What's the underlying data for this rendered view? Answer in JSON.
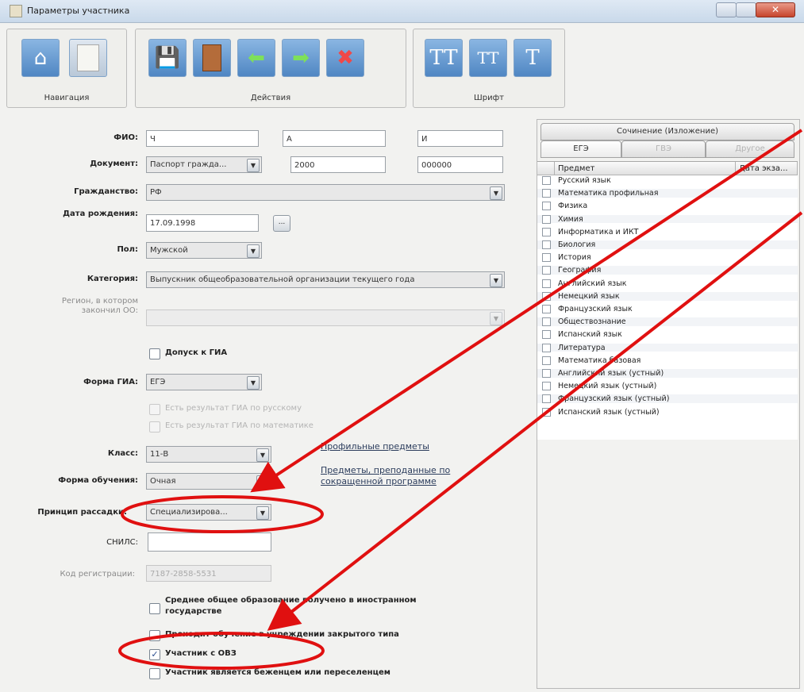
{
  "window": {
    "title": "Параметры участника"
  },
  "toolbar": {
    "groups": [
      {
        "label": "Навигация"
      },
      {
        "label": "Действия"
      },
      {
        "label": "Шрифт"
      }
    ],
    "icons": {
      "home": "home-icon",
      "document": "document-icon",
      "save": "save-icon",
      "exit": "exit-door-icon",
      "back": "arrow-left-icon",
      "forward": "arrow-right-icon",
      "delete": "delete-x-icon",
      "font_decrease": "font-decrease-icon",
      "font_increase": "font-increase-icon",
      "font_default": "font-default-icon"
    },
    "font_glyph_1": "TT",
    "font_glyph_2": "TT",
    "font_glyph_3": "T"
  },
  "form": {
    "fio_label": "ФИО:",
    "fio_last": "Ч",
    "fio_first": "А",
    "fio_middle": "И",
    "document_label": "Документ:",
    "document_type": "Паспорт гражда...",
    "document_series": "2000",
    "document_number": "000000",
    "citizenship_label": "Гражданство:",
    "citizenship_value": "РФ",
    "birthdate_label": "Дата рождения:",
    "birthdate_value": "17.09.1998",
    "birthdate_button": "...",
    "sex_label": "Пол:",
    "sex_value": "Мужской",
    "category_label": "Категория:",
    "category_value": "Выпускник общеобразовательной организации текущего года",
    "region_label": "Регион, в котором закончил ОО:",
    "gia_admission_label": "Допуск к ГИА",
    "gia_form_label": "Форма ГИА:",
    "gia_form_value": "ЕГЭ",
    "gia_result_russian": "Есть результат ГИА по русскому",
    "gia_result_math": "Есть результат ГИА по математике",
    "class_label": "Класс:",
    "class_value": "11-В",
    "study_form_label": "Форма обучения:",
    "study_form_value": "Очная",
    "seating_label": "Принцип рассадки:",
    "seating_value": "Специализирова...",
    "snils_label": "СНИЛС:",
    "snils_value": "",
    "reg_code_label": "Код регистрации:",
    "reg_code_value": "7187-2858-5531",
    "link_profile": "Профильные предметы",
    "link_reduced": "Предметы, преподанные по сокращенной программе",
    "chk_foreign": "Среднее общее образование получено в иностранном государстве",
    "chk_closed": "Проходит обучение в учреждении закрытого типа",
    "chk_ovz": "Участник с ОВЗ",
    "chk_refugee": "Участник является беженцем или переселенцем",
    "checked_mark": "✓"
  },
  "right": {
    "tab_essay": "Сочинение (Изложение)",
    "tab_ege": "ЕГЭ",
    "tab_gve": "ГВЭ",
    "tab_other": "Другое",
    "col_subject": "Предмет",
    "col_date": "Дата экза...",
    "subjects": [
      "Русский язык",
      "Математика профильная",
      "Физика",
      "Химия",
      "Информатика и ИКТ",
      "Биология",
      "История",
      "География",
      "Английский язык",
      "Немецкий язык",
      "Французский язык",
      "Обществознание",
      "Испанский язык",
      "Литература",
      "Математика базовая",
      "Английский язык (устный)",
      "Немецкий язык (устный)",
      "Французский язык (устный)",
      "Испанский язык (устный)"
    ]
  },
  "colors": {
    "annotation": "#e01010",
    "accent": "#4f86c3"
  }
}
